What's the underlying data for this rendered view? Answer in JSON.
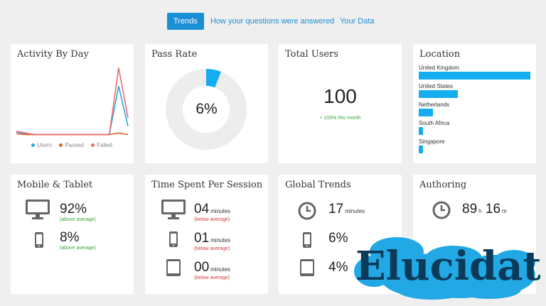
{
  "nav": {
    "tabs": [
      {
        "label": "Trends",
        "active": true
      },
      {
        "label": "How your questions were answered",
        "active": false
      },
      {
        "label": "Your Data",
        "active": false
      }
    ]
  },
  "colors": {
    "accent": "#1a8fd6",
    "bar": "#14aef0",
    "users": "#2aa7e0",
    "passed": "#e0622d",
    "failed": "#ef6b73",
    "green": "#3aa63a",
    "red": "#cc3b3b",
    "logo_text": "#0c3b5a",
    "logo_cloud": "#22a8e4"
  },
  "activity": {
    "title": "Activity By Day",
    "legend": [
      "Users",
      "Passed",
      "Failed"
    ],
    "chart_data": {
      "type": "line",
      "x": [
        1,
        2,
        3,
        4,
        5,
        6,
        7,
        8,
        9,
        10,
        11,
        12,
        13
      ],
      "series": [
        {
          "name": "Users",
          "values": [
            5,
            3,
            2,
            2,
            2,
            2,
            2,
            2,
            2,
            2,
            2,
            60,
            12
          ]
        },
        {
          "name": "Passed",
          "values": [
            3,
            2,
            2,
            2,
            2,
            2,
            2,
            2,
            2,
            2,
            2,
            4,
            2
          ]
        },
        {
          "name": "Failed",
          "values": [
            6,
            4,
            2,
            2,
            2,
            2,
            2,
            2,
            2,
            2,
            2,
            82,
            22
          ]
        }
      ],
      "ylim": [
        0,
        90
      ]
    }
  },
  "pass_rate": {
    "title": "Pass Rate",
    "value": "6%",
    "fraction": 0.06
  },
  "total_users": {
    "title": "Total Users",
    "value": "100",
    "change": "+ 100% this month"
  },
  "location": {
    "title": "Location",
    "items": [
      {
        "label": "United Kingdom",
        "value": 100
      },
      {
        "label": "United States",
        "value": 35
      },
      {
        "label": "Netherlands",
        "value": 13
      },
      {
        "label": "South Africa",
        "value": 4
      },
      {
        "label": "Singapore",
        "value": 4
      }
    ]
  },
  "mobile": {
    "title": "Mobile & Tablet",
    "rows": [
      {
        "icon": "monitor-icon",
        "value": "92%",
        "note": "(above average)"
      },
      {
        "icon": "mobile-phone-icon",
        "value": "8%",
        "note": "(above average)"
      }
    ]
  },
  "time_spent": {
    "title": "Time Spent Per Session",
    "rows": [
      {
        "icon": "monitor-icon",
        "value": "04",
        "unit": "minutes",
        "note": "(below average)"
      },
      {
        "icon": "mobile-phone-icon",
        "value": "01",
        "unit": "minutes",
        "note": "(below average)"
      },
      {
        "icon": "tablet-icon",
        "value": "00",
        "unit": "minutes",
        "note": "(below average)"
      }
    ]
  },
  "global_trends": {
    "title": "Global Trends",
    "rows": [
      {
        "icon": "clock-icon",
        "value": "17",
        "unit": "minutes"
      },
      {
        "icon": "mobile-phone-icon",
        "value": "6%"
      },
      {
        "icon": "tablet-icon",
        "value": "4%"
      }
    ]
  },
  "authoring": {
    "title": "Authoring",
    "icon": "clock-icon",
    "hours": "89",
    "hours_unit": "h",
    "minutes": "16",
    "minutes_unit": "m"
  },
  "logo": {
    "text": "Elucidat"
  }
}
